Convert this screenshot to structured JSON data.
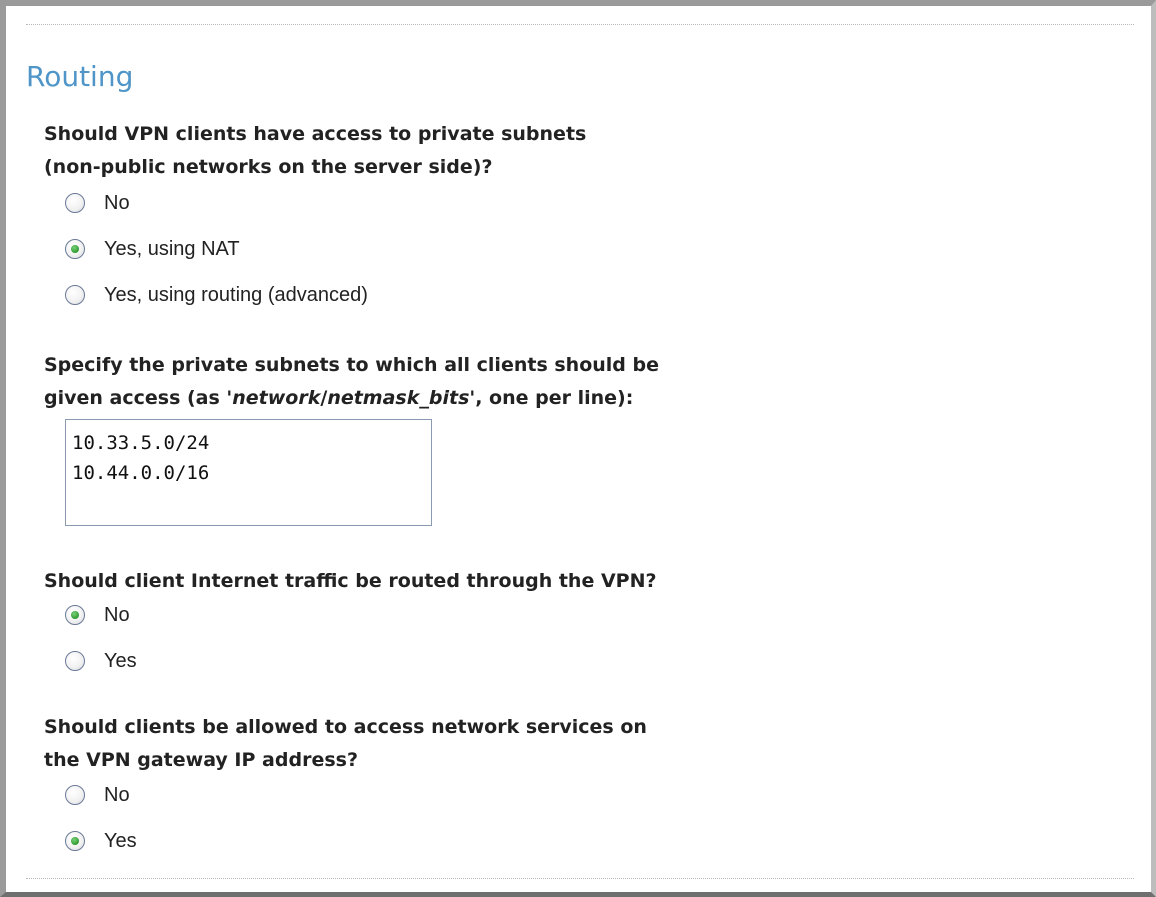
{
  "section": {
    "title": "Routing"
  },
  "questions": {
    "private_access": {
      "lines": [
        "Should VPN clients have access to private subnets",
        "(non-public networks on the server side)?"
      ],
      "options": [
        "No",
        "Yes, using NAT",
        "Yes, using routing (advanced)"
      ],
      "selected": "Yes, using NAT"
    },
    "subnets": {
      "line1": "Specify the private subnets to which all clients should be",
      "line2_prefix": "given access (as '",
      "line2_em1": "network",
      "line2_sep": "/",
      "line2_em2": "netmask_bits",
      "line2_suffix": "', one per line):",
      "entries": [
        "10.33.5.0/24",
        "10.44.0.0/16"
      ]
    },
    "internet_traffic": {
      "lines": [
        "Should client Internet traffic be routed through the VPN?"
      ],
      "options": [
        "No",
        "Yes"
      ],
      "selected": "No"
    },
    "gateway_services": {
      "lines": [
        "Should clients be allowed to access network services on",
        "the VPN gateway IP address?"
      ],
      "options": [
        "No",
        "Yes"
      ],
      "selected": "Yes"
    }
  },
  "colors": {
    "title": "#4f95c8",
    "radio_checked": "#2e9a2e",
    "text": "#222222"
  }
}
